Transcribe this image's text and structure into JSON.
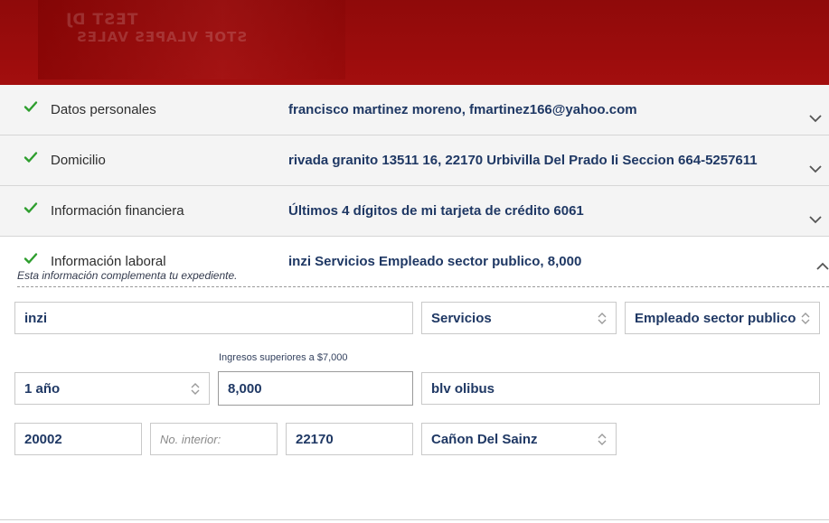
{
  "banner": {
    "mirrored_line1": "TEST DJ",
    "mirrored_line2": "STOF VLAPES VALES"
  },
  "sections": [
    {
      "title": "Datos personales",
      "summary": "francisco martinez moreno, fmartinez166@yahoo.com",
      "state": "completed"
    },
    {
      "title": "Domicilio",
      "summary": "rivada granito 13511 16, 22170 Urbivilla Del Prado Ii Seccion 664-5257611",
      "state": "completed"
    },
    {
      "title": "Información financiera",
      "summary": "Últimos 4 dígitos de mi tarjeta de crédito 6061",
      "state": "completed"
    },
    {
      "title": "Información laboral",
      "summary": "inzi Servicios Empleado sector publico, 8,000",
      "state": "expanded"
    }
  ],
  "form": {
    "note": "Esta información complementa tu expediente.",
    "company": "inzi",
    "sector": "Servicios",
    "occupation": "Empleado sector publico",
    "income_hint": "Ingresos superiores a $7,000",
    "seniority": "1 año",
    "income": "8,000",
    "street": "blv olibus",
    "ext_number": "20002",
    "int_number_placeholder": "No. interior:",
    "zip": "22170",
    "colony": "Cañon Del Sainz"
  },
  "colors": {
    "banner": "#9b0c0c",
    "check": "#2e9e2e",
    "value_text": "#1f3864"
  },
  "icons": {
    "completed": "check-icon",
    "collapsed": "chevron-down-icon",
    "expanded": "chevron-up-icon",
    "select": "select-arrows-icon"
  }
}
